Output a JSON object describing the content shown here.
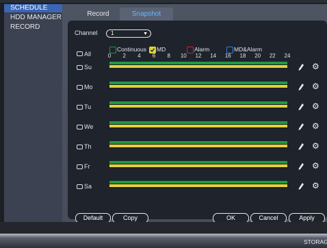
{
  "sidebar": {
    "items": [
      {
        "label": "SCHEDULE",
        "active": true
      },
      {
        "label": "HDD MANAGER",
        "active": false
      },
      {
        "label": "RECORD",
        "active": false
      }
    ]
  },
  "tabs": [
    {
      "label": "Record",
      "active": false
    },
    {
      "label": "Snapshot",
      "active": true
    }
  ],
  "channel": {
    "label": "Channel",
    "value": "1"
  },
  "all_label": "All",
  "legend": [
    {
      "label": "Continuous",
      "color": "#1e9a45",
      "checked": false
    },
    {
      "label": "MD",
      "color": "#e2d33a",
      "checked": true
    },
    {
      "label": "Alarm",
      "color": "#d2202f",
      "checked": false
    },
    {
      "label": "MD&Alarm",
      "color": "#2d7fe0",
      "checked": false
    }
  ],
  "hour_ticks": [
    "0",
    "2",
    "4",
    "6",
    "8",
    "10",
    "12",
    "14",
    "16",
    "18",
    "20",
    "22",
    "24"
  ],
  "days": [
    {
      "label": "Su"
    },
    {
      "label": "Mo"
    },
    {
      "label": "Tu"
    },
    {
      "label": "We"
    },
    {
      "label": "Th"
    },
    {
      "label": "Fr"
    },
    {
      "label": "Sa"
    }
  ],
  "buttons": {
    "default": "Default",
    "copy": "Copy",
    "ok": "OK",
    "cancel": "Cancel",
    "apply": "Apply"
  },
  "status": {
    "storage": "STORAGE"
  },
  "colors": {
    "accent": "#3a66b4",
    "tab_active_text": "#6ab8ff"
  }
}
